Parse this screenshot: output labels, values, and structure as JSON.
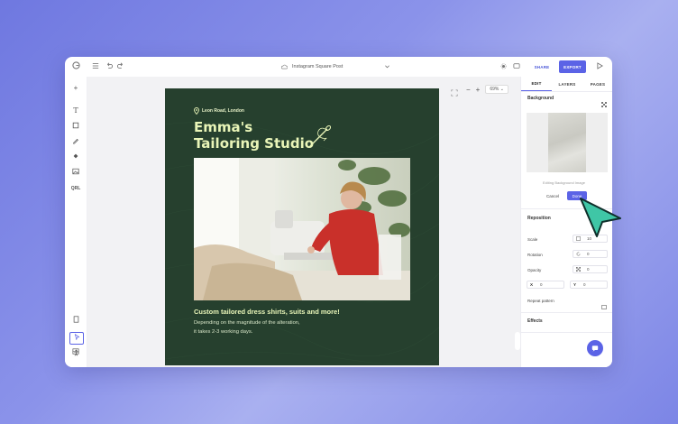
{
  "topbar": {
    "doc_title": "Instagram Square Post",
    "share_label": "SHARE",
    "export_label": "EXPORT"
  },
  "canvas": {
    "zoom_value": "69%"
  },
  "poster": {
    "location": "Leon Road, London",
    "title": "Emma's\nTailoring Studio",
    "tagline": "Custom tailored dress shirts, suits and more!",
    "description": "Depending on the magnitude of the alteration,\nit takes 2-3 working days."
  },
  "panel": {
    "tabs": [
      "EDIT",
      "LAYERS",
      "PAGES"
    ],
    "background_title": "Background",
    "editing_label": "Editing Background Image",
    "cancel_label": "Cancel",
    "done_label": "Done",
    "reposition_title": "Reposition",
    "scale_label": "Scale",
    "scale_value": "10",
    "rotation_label": "Rotation",
    "rotation_value": "0",
    "opacity_label": "Opacity",
    "opacity_value": "0",
    "x_label": "X",
    "x_value": "0",
    "y_label": "Y",
    "y_value": "0",
    "repeat_label": "Repeat pattern",
    "effects_title": "Effects"
  },
  "colors": {
    "accent": "#5b63e6",
    "poster_bg": "#26402e",
    "poster_text": "#e9f5b8",
    "cursor": "#3fc6a6"
  }
}
